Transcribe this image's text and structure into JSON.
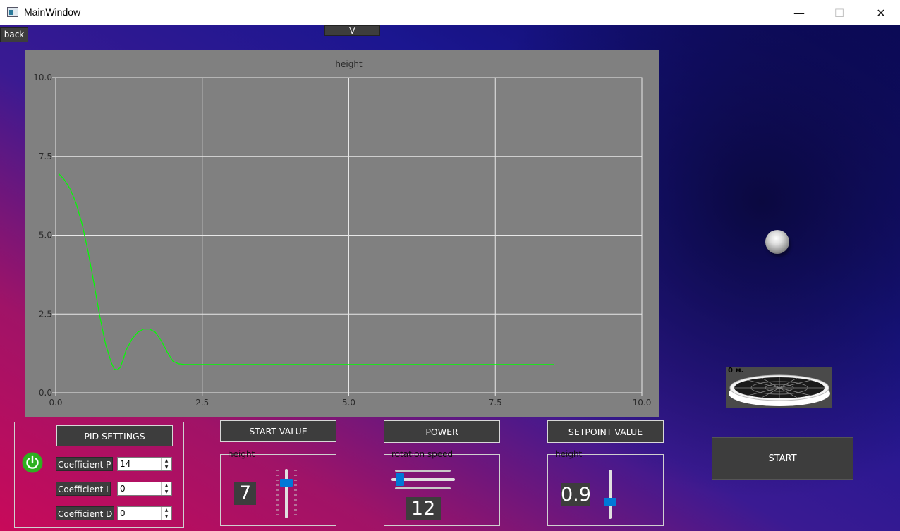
{
  "window": {
    "title": "MainWindow",
    "minimize_glyph": "—",
    "maximize_glyph": "☐",
    "close_glyph": "✕"
  },
  "toolbar": {
    "back_label": "back",
    "v_label": "V"
  },
  "chart_data": {
    "type": "line",
    "title": "height",
    "xlim": [
      0,
      10
    ],
    "ylim": [
      0,
      10
    ],
    "x_ticks": [
      "0.0",
      "2.5",
      "5.0",
      "7.5",
      "10.0"
    ],
    "y_ticks": [
      "0.0",
      "2.5",
      "5.0",
      "7.5",
      "10.0"
    ],
    "x_tick_values": [
      0,
      2.5,
      5,
      7.5,
      10
    ],
    "y_tick_values": [
      0,
      2.5,
      5,
      7.5,
      10
    ],
    "grid": true,
    "line_color": "#00ff00",
    "background": "#808080",
    "series": [
      {
        "x": [
          0.05,
          0.15,
          0.25,
          0.35,
          0.45,
          0.55,
          0.65,
          0.75,
          0.85,
          0.95,
          1.0,
          1.05,
          1.1,
          1.15,
          1.2,
          1.3,
          1.4,
          1.5,
          1.6,
          1.7,
          1.8,
          1.9,
          2.0,
          2.1,
          2.2,
          2.3,
          3.0,
          4.0,
          5.0,
          6.0,
          7.0,
          8.0,
          8.5
        ],
        "y": [
          6.95,
          6.75,
          6.45,
          6.0,
          5.35,
          4.5,
          3.5,
          2.45,
          1.55,
          0.95,
          0.75,
          0.73,
          0.8,
          1.05,
          1.35,
          1.7,
          1.92,
          2.02,
          2.02,
          1.92,
          1.65,
          1.3,
          1.0,
          0.92,
          0.9,
          0.9,
          0.9,
          0.9,
          0.9,
          0.9,
          0.9,
          0.9,
          0.9
        ]
      }
    ]
  },
  "simulation": {
    "fan_label": "0 м."
  },
  "pid": {
    "title": "PID SETTINGS",
    "p_label": "Coefficient P",
    "p_value": "14",
    "i_label": "Coefficient I",
    "i_value": "0",
    "d_label": "Coefficient D",
    "d_value": "0",
    "power_color": "#2fb01f"
  },
  "start_value": {
    "button": "START VALUE",
    "group_title": "height",
    "display": "7",
    "slider_level": 0.7
  },
  "power": {
    "button": "POWER",
    "group_title": "rotation speed",
    "display": "12",
    "slider_level": 0.12
  },
  "setpoint": {
    "button": "SETPOINT VALUE",
    "group_title": "height",
    "display": "0.9",
    "slider_level": 0.09
  },
  "start_button": "START"
}
